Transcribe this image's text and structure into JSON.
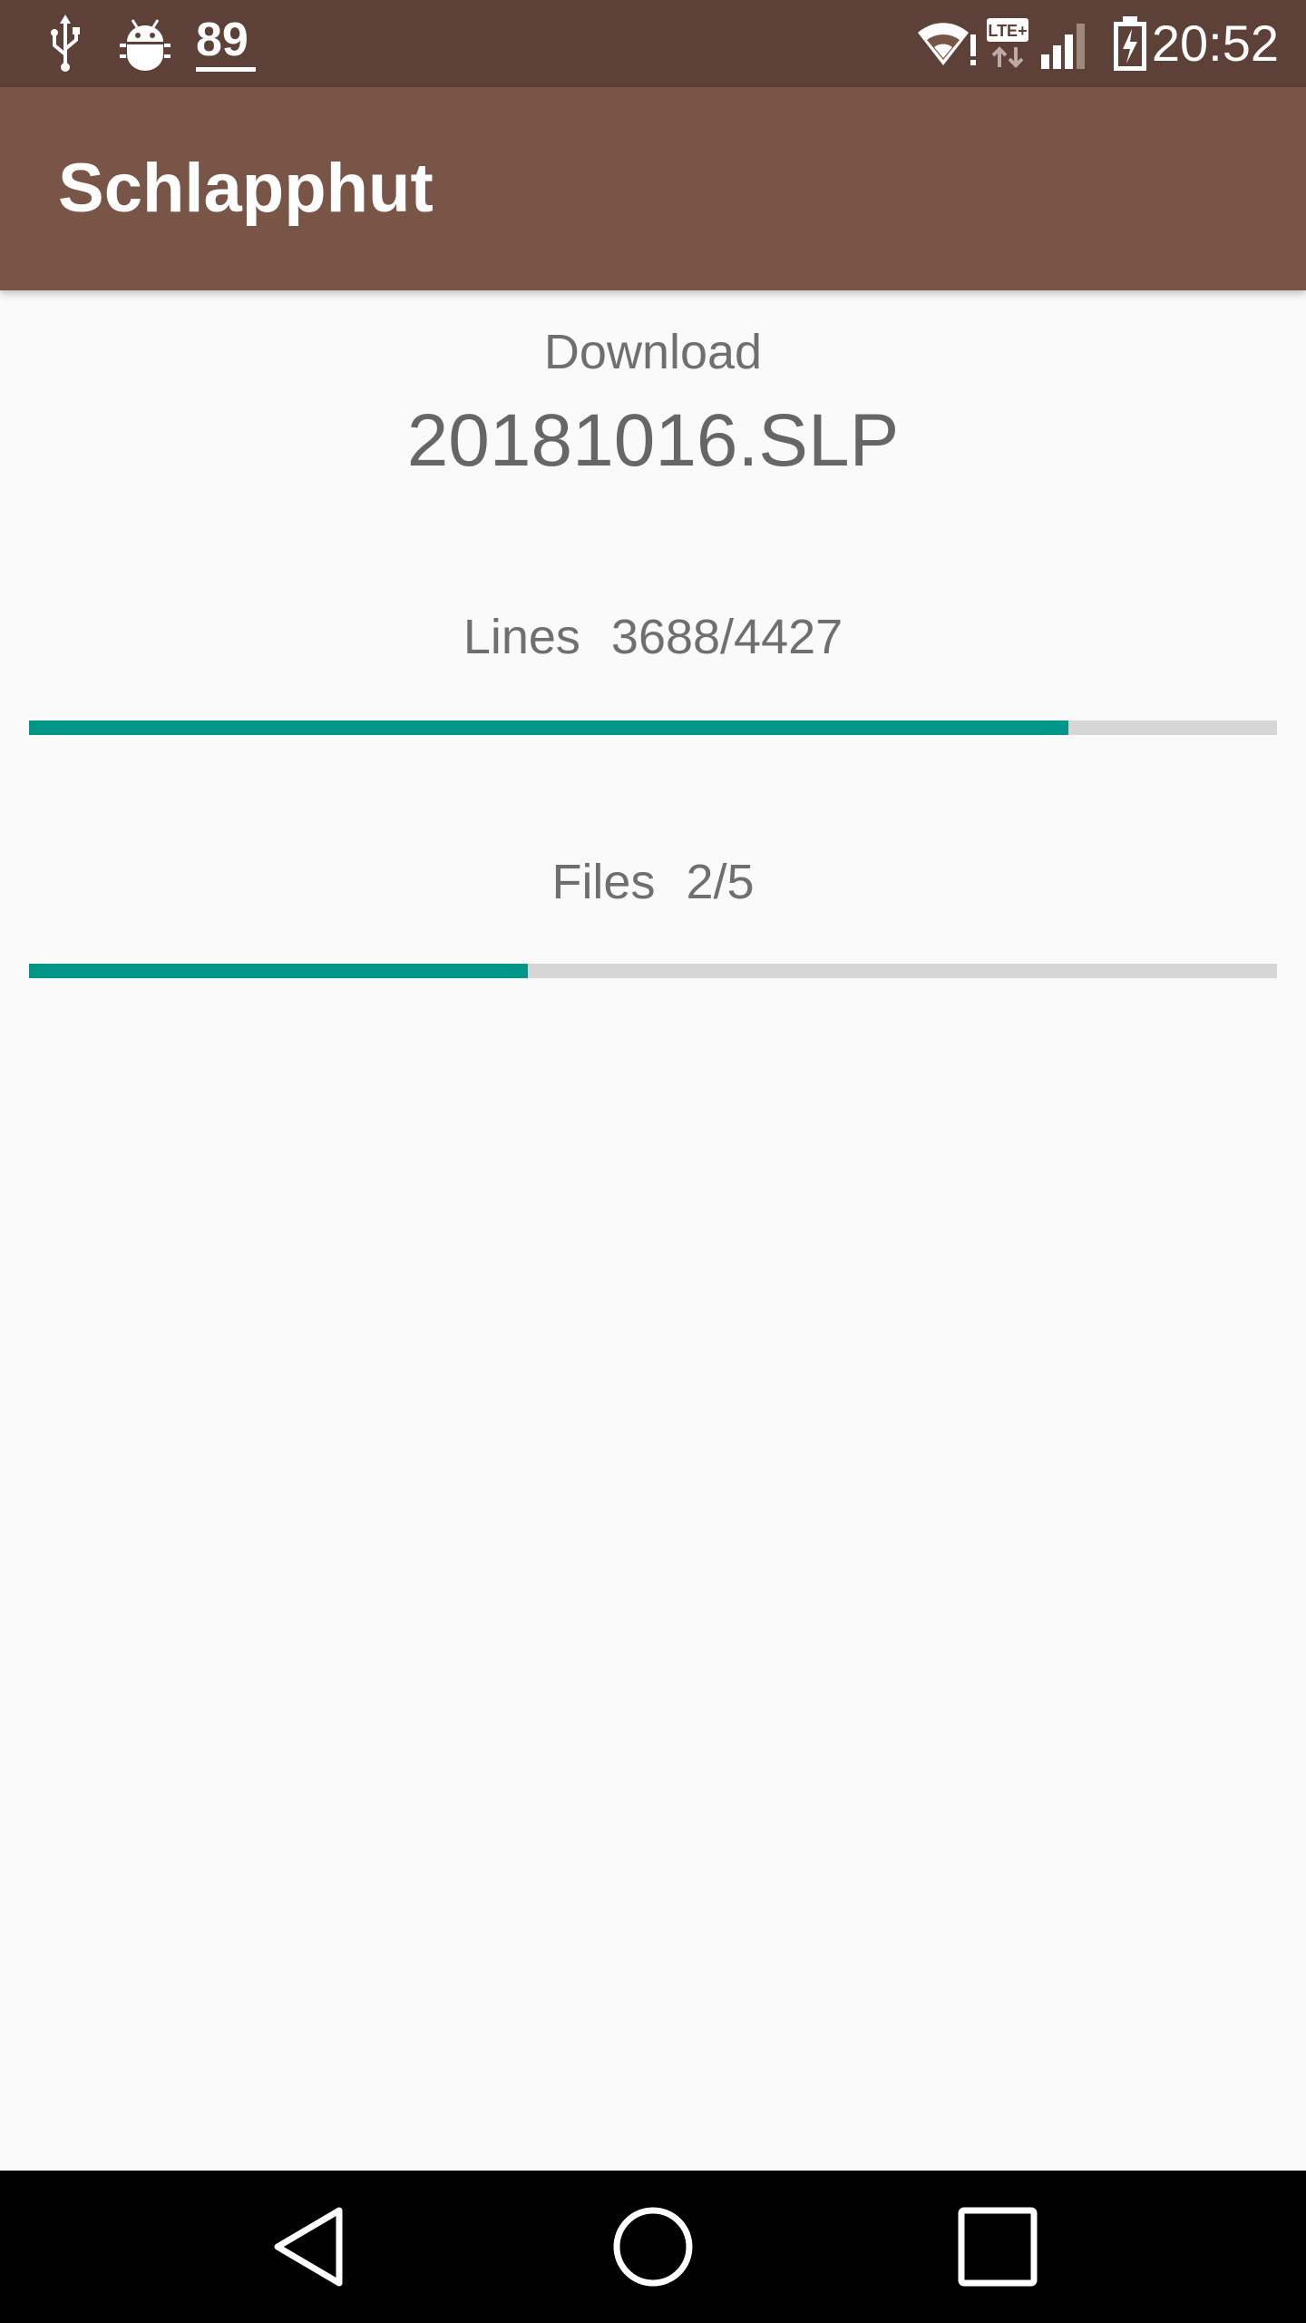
{
  "status_bar": {
    "notification_icons": [
      "usb-icon",
      "android-debug-icon"
    ],
    "badge_number": "89",
    "system_icons": [
      "wifi-alert-icon",
      "lte-plus-icon",
      "signal-icon",
      "battery-charging-icon"
    ],
    "time": "20:52",
    "colors": {
      "background": "#5d4037"
    }
  },
  "app_bar": {
    "title": "Schlapphut",
    "colors": {
      "background": "#795548"
    }
  },
  "download": {
    "label": "Download",
    "file_name": "20181016.SLP"
  },
  "lines_progress": {
    "label": "Lines",
    "value": "3688/4427",
    "current": 3688,
    "total": 4427
  },
  "files_progress": {
    "label": "Files",
    "value": "2/5",
    "current": 2,
    "total": 5
  },
  "colors": {
    "progress_fill": "#009688",
    "progress_track": "#d6d6d6"
  },
  "nav_bar": {
    "buttons": [
      "back-icon",
      "home-icon",
      "recents-icon"
    ]
  }
}
